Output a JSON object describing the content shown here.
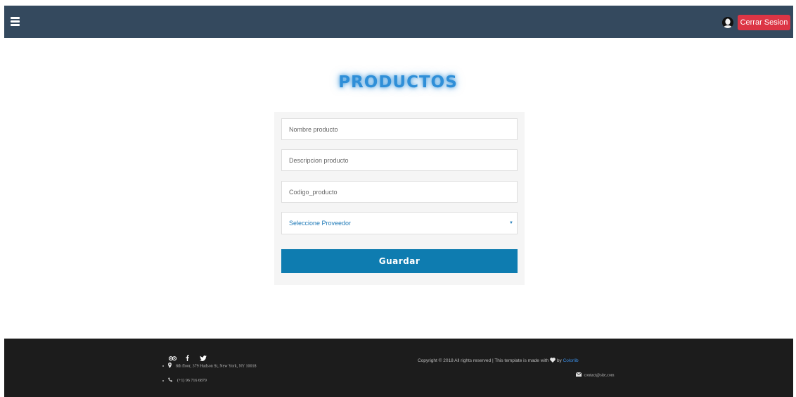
{
  "header": {
    "menu_icon": "hamburger-icon",
    "user_icon": "user-avatar-icon",
    "logout_label": "Cerrar Sesion",
    "background_color": "#34495e",
    "logout_color": "#dc3545"
  },
  "main": {
    "title": "PRODUCTOS",
    "title_color": "#2f8fd8",
    "form": {
      "name_placeholder": "Nombre producto",
      "description_placeholder": "Descripcion producto",
      "code_placeholder": "Codigo_producto",
      "name_value": "",
      "description_value": "",
      "code_value": "",
      "supplier_selected": "Seleccione Proveedor",
      "save_label": "Guardar",
      "save_color": "#0e7cb0"
    }
  },
  "footer": {
    "social_icons": [
      "tripadvisor-icon",
      "facebook-icon",
      "twitter-icon"
    ],
    "address_icon": "map-marker-icon",
    "address": "8th floor, 379 Hudson St, New York, NY 10018",
    "phone_icon": "phone-icon",
    "phone": "(+1) 96 716 6879",
    "copyright_text": "Copyright © 2018 All rights reserved | This template is made with",
    "copyright_by": "by",
    "copyright_link": "Colorlib",
    "heart_icon": "heart-icon",
    "email_icon": "envelope-icon",
    "email": "contact@site.com",
    "background_color": "#1c1c1c"
  }
}
